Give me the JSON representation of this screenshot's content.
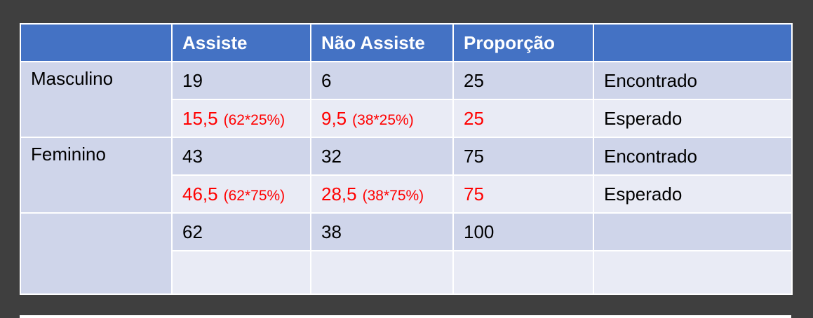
{
  "header": {
    "col0": "",
    "col1": "Assiste",
    "col2": "Não Assiste",
    "col3": "Proporção",
    "col4": ""
  },
  "rows": {
    "masculino": {
      "label": "Masculino",
      "found": {
        "assiste": "19",
        "nao_assiste": "6",
        "proporcao": "25",
        "tipo": "Encontrado"
      },
      "expected": {
        "assiste": "15,5",
        "assiste_note": "(62*25%)",
        "nao_assiste": "9,5",
        "nao_assiste_note": "(38*25%)",
        "proporcao": "25",
        "tipo": "Esperado"
      }
    },
    "feminino": {
      "label": "Feminino",
      "found": {
        "assiste": "43",
        "nao_assiste": "32",
        "proporcao": "75",
        "tipo": "Encontrado"
      },
      "expected": {
        "assiste": "46,5",
        "assiste_note": "(62*75%)",
        "nao_assiste": "28,5",
        "nao_assiste_note": "(38*75%)",
        "proporcao": "75",
        "tipo": "Esperado"
      }
    },
    "total": {
      "label": "",
      "assiste": "62",
      "nao_assiste": "38",
      "proporcao": "100",
      "tipo": ""
    }
  },
  "colors": {
    "header_bg": "#4472c4",
    "row_dark": "#cfd5ea",
    "row_light": "#e9ebf5",
    "expected_text": "#ff0000",
    "frame_bg": "#3f3f3f"
  }
}
